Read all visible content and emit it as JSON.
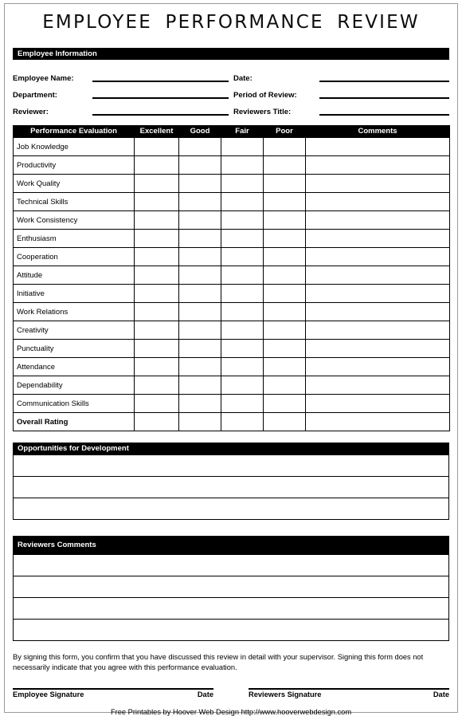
{
  "document": {
    "title": "EMPLOYEE PERFORMANCE REVIEW"
  },
  "employee_information": {
    "section_title": "Employee Information",
    "left_fields": [
      {
        "label": "Employee Name:",
        "value": ""
      },
      {
        "label": "Department:",
        "value": ""
      },
      {
        "label": "Reviewer:",
        "value": ""
      }
    ],
    "right_fields": [
      {
        "label": "Date:",
        "value": ""
      },
      {
        "label": "Period of Review:",
        "value": ""
      },
      {
        "label": "Reviewers Title:",
        "value": ""
      }
    ]
  },
  "evaluation": {
    "columns": [
      "Performance Evaluation",
      "Excellent",
      "Good",
      "Fair",
      "Poor",
      "Comments"
    ],
    "rows": [
      {
        "criterion": "Job Knowledge",
        "excellent": "",
        "good": "",
        "fair": "",
        "poor": "",
        "comments": ""
      },
      {
        "criterion": "Productivity",
        "excellent": "",
        "good": "",
        "fair": "",
        "poor": "",
        "comments": ""
      },
      {
        "criterion": "Work Quality",
        "excellent": "",
        "good": "",
        "fair": "",
        "poor": "",
        "comments": ""
      },
      {
        "criterion": "Technical Skills",
        "excellent": "",
        "good": "",
        "fair": "",
        "poor": "",
        "comments": ""
      },
      {
        "criterion": "Work Consistency",
        "excellent": "",
        "good": "",
        "fair": "",
        "poor": "",
        "comments": ""
      },
      {
        "criterion": "Enthusiasm",
        "excellent": "",
        "good": "",
        "fair": "",
        "poor": "",
        "comments": ""
      },
      {
        "criterion": "Cooperation",
        "excellent": "",
        "good": "",
        "fair": "",
        "poor": "",
        "comments": ""
      },
      {
        "criterion": "Attitude",
        "excellent": "",
        "good": "",
        "fair": "",
        "poor": "",
        "comments": ""
      },
      {
        "criterion": "Initiative",
        "excellent": "",
        "good": "",
        "fair": "",
        "poor": "",
        "comments": ""
      },
      {
        "criterion": "Work Relations",
        "excellent": "",
        "good": "",
        "fair": "",
        "poor": "",
        "comments": ""
      },
      {
        "criterion": "Creativity",
        "excellent": "",
        "good": "",
        "fair": "",
        "poor": "",
        "comments": ""
      },
      {
        "criterion": "Punctuality",
        "excellent": "",
        "good": "",
        "fair": "",
        "poor": "",
        "comments": ""
      },
      {
        "criterion": "Attendance",
        "excellent": "",
        "good": "",
        "fair": "",
        "poor": "",
        "comments": ""
      },
      {
        "criterion": "Dependability",
        "excellent": "",
        "good": "",
        "fair": "",
        "poor": "",
        "comments": ""
      },
      {
        "criterion": "Communication Skills",
        "excellent": "",
        "good": "",
        "fair": "",
        "poor": "",
        "comments": ""
      }
    ],
    "summary_row": {
      "criterion": "Overall Rating",
      "excellent": "",
      "good": "",
      "fair": "",
      "poor": "",
      "comments": ""
    },
    "summary_row_fill": "#c0c0c0"
  },
  "opportunities_for_development": {
    "section_title": "Opportunities for Development",
    "lines": [
      "",
      "",
      ""
    ]
  },
  "reviewers_comments": {
    "section_title": "Reviewers Comments",
    "lines": [
      "",
      "",
      "",
      ""
    ]
  },
  "disclaimer": {
    "text": "By signing this form, you confirm that you have discussed this review in detail with your supervisor. Signing this form does not necessarily indicate that you agree with this performance evaluation."
  },
  "signatures": {
    "employee": {
      "label": "Employee Signature",
      "date_label": "Date",
      "value": "",
      "date_value": ""
    },
    "reviewer": {
      "label": "Reviewers Signature",
      "date_label": "Date",
      "value": "",
      "date_value": ""
    }
  },
  "footer": {
    "credit": "Free Printables by Hoover Web Design http://www.hooverwebdesign.com"
  },
  "colors": {
    "bar_background": "#000000",
    "bar_text": "#ffffff",
    "summary_fill": "#c0c0c0",
    "rule": "#000000",
    "page": "#ffffff"
  }
}
